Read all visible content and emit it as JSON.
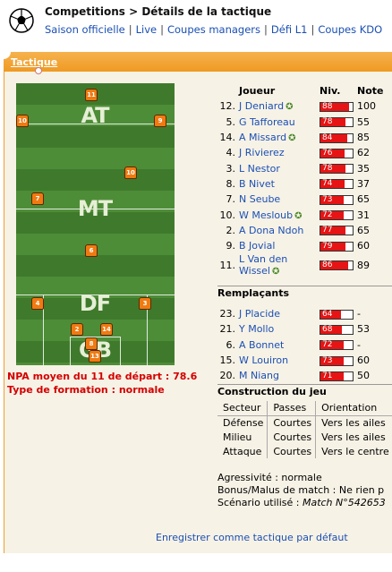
{
  "header": {
    "breadcrumb": "Competitions > Détails de la tactique",
    "nav": [
      "Saison officielle",
      "Live",
      "Coupes managers",
      "Défi L1",
      "Coupes KDO"
    ]
  },
  "tab": {
    "label": "Tactique"
  },
  "field": {
    "zones": [
      "AT",
      "MT",
      "DF",
      "GB"
    ],
    "shirts": [
      "11",
      "10",
      "9",
      "10",
      "7",
      "6",
      "4",
      "3",
      "2",
      "14",
      "8",
      "13"
    ]
  },
  "summary": {
    "npa": "NPA moyen du 11 de départ : 78.6",
    "formation": "Type de formation : normale"
  },
  "table": {
    "headers": [
      "Joueur",
      "Niv.",
      "Note"
    ],
    "starters": [
      {
        "n": "12.",
        "name": "J Deniard",
        "niv": 88,
        "note": "100",
        "star": true
      },
      {
        "n": "5.",
        "name": "G Tafforeau",
        "niv": 78,
        "note": "55",
        "star": false
      },
      {
        "n": "14.",
        "name": "A Missard",
        "niv": 84,
        "note": "85",
        "star": true
      },
      {
        "n": "4.",
        "name": "J Rivierez",
        "niv": 76,
        "note": "62",
        "star": false
      },
      {
        "n": "3.",
        "name": "L Nestor",
        "niv": 78,
        "note": "35",
        "star": false
      },
      {
        "n": "8.",
        "name": "B Nivet",
        "niv": 74,
        "note": "37",
        "star": false
      },
      {
        "n": "7.",
        "name": "N Seube",
        "niv": 73,
        "note": "65",
        "star": false
      },
      {
        "n": "10.",
        "name": "W Mesloub",
        "niv": 72,
        "note": "31",
        "star": true
      },
      {
        "n": "2.",
        "name": "A Dona Ndoh",
        "niv": 77,
        "note": "65",
        "star": false
      },
      {
        "n": "9.",
        "name": "B Jovial",
        "niv": 79,
        "note": "60",
        "star": false
      },
      {
        "n": "11.",
        "name": "L Van den Wissel",
        "niv": 86,
        "note": "89",
        "star": true
      }
    ],
    "subs_title": "Remplaçants",
    "subs": [
      {
        "n": "23.",
        "name": "J Placide",
        "niv": 64,
        "note": "-"
      },
      {
        "n": "21.",
        "name": "Y Mollo",
        "niv": 68,
        "note": "53"
      },
      {
        "n": "6.",
        "name": "A Bonnet",
        "niv": 72,
        "note": "-"
      },
      {
        "n": "15.",
        "name": "W Louiron",
        "niv": 73,
        "note": "60"
      },
      {
        "n": "20.",
        "name": "M Niang",
        "niv": 71,
        "note": "50"
      }
    ]
  },
  "construction": {
    "title": "Construction du jeu",
    "headers": [
      "Secteur",
      "Passes",
      "Orientation"
    ],
    "rows": [
      [
        "Défense",
        "Courtes",
        "Vers les ailes"
      ],
      [
        "Milieu",
        "Courtes",
        "Vers les ailes"
      ],
      [
        "Attaque",
        "Courtes",
        "Vers le centre"
      ]
    ]
  },
  "info": {
    "agressivite": "Agressivité : normale",
    "bonus": "Bonus/Malus de match : Ne rien p",
    "scenario_label": "Scénario utilisé : ",
    "scenario_value": "Match N°542653"
  },
  "footer": {
    "save": "Enregistrer comme tactique par défaut"
  },
  "colors": {
    "tab": "#ef9a22",
    "bar": "#e61414",
    "link": "#1a4fb3",
    "alert": "#d40000"
  }
}
